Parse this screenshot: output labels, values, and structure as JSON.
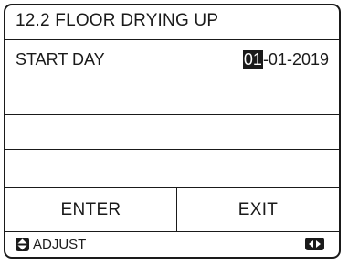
{
  "screen": {
    "title": "12.2 FLOOR DRYING UP"
  },
  "start_day": {
    "label": "START DAY",
    "day": "01",
    "rest_of_date": "-01-2019"
  },
  "buttons": {
    "enter": "ENTER",
    "exit": "EXIT"
  },
  "footer": {
    "adjust_label": "ADJUST",
    "adjust_icon": "up-down-arrows-icon",
    "nav_icon": "left-right-arrows-icon"
  }
}
